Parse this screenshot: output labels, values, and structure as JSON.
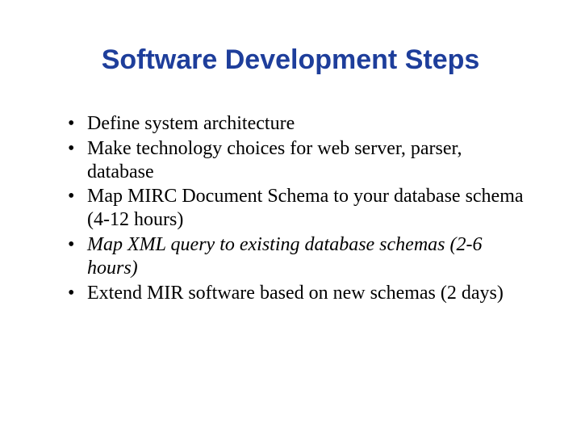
{
  "title": "Software Development Steps",
  "bullets": [
    {
      "text": "Define system architecture",
      "italic": false
    },
    {
      "text": "Make technology choices for web server, parser, database",
      "italic": false
    },
    {
      "text": "Map MIRC Document Schema to your database schema (4-12 hours)",
      "italic": false
    },
    {
      "text": "Map XML query to existing database schemas (2-6 hours)",
      "italic": true
    },
    {
      "text": "Extend MIR software based on new schemas (2 days)",
      "italic": false
    }
  ]
}
